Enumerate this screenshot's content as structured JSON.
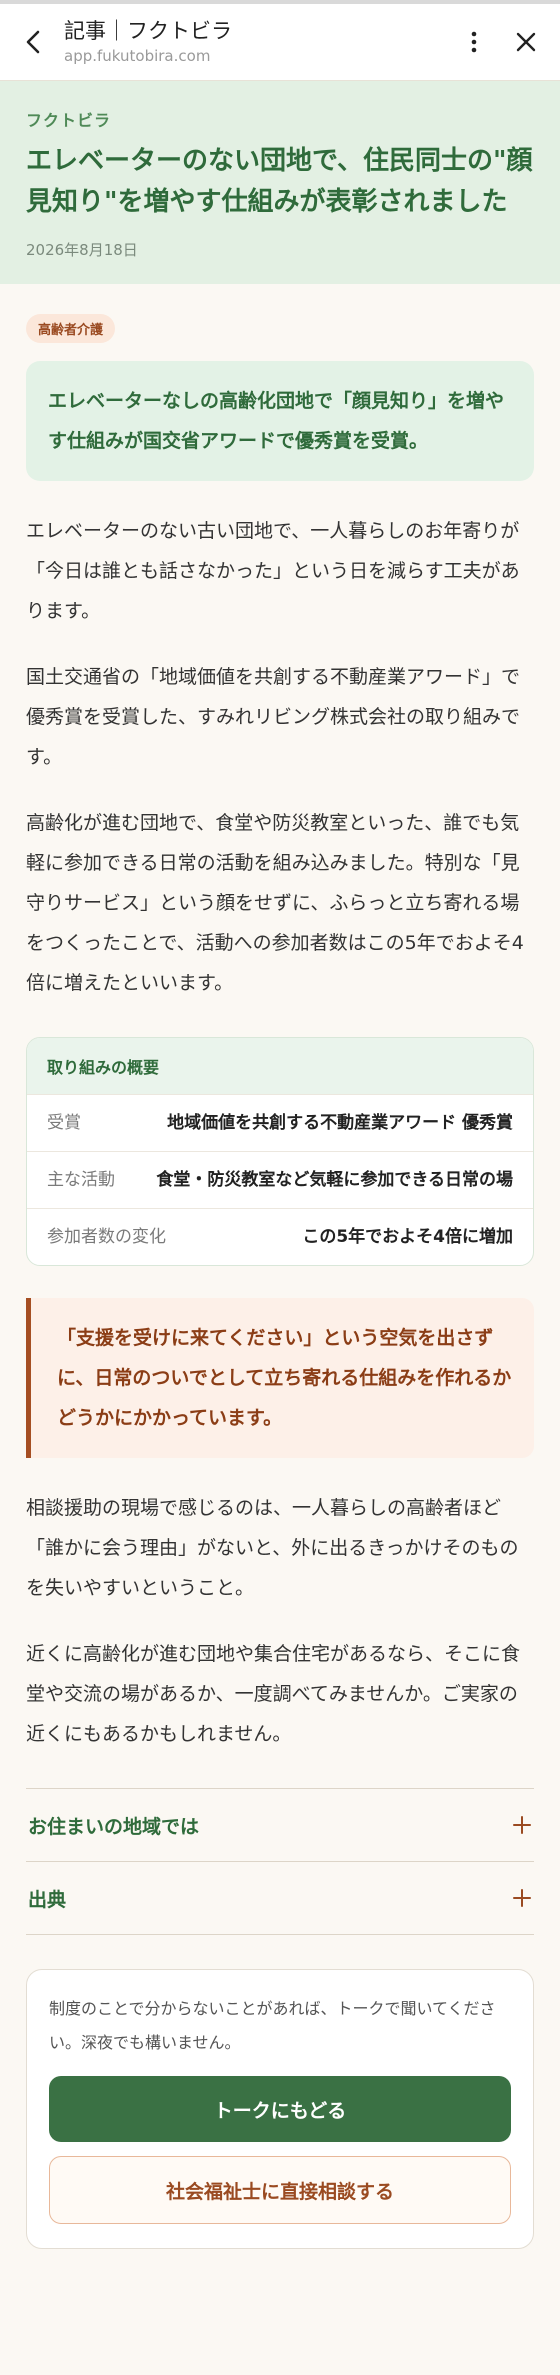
{
  "appbar": {
    "title": "記事｜フクトビラ",
    "url": "app.fukutobira.com",
    "icons": [
      "chevron-left-icon",
      "more-vertical-icon",
      "close-icon"
    ]
  },
  "hero": {
    "brand": "フクトビラ",
    "headline": "エレベーターのない団地で、住民同士の\"顔見知り\"を増やす仕組みが表彰されました",
    "date": "2026年8月18日"
  },
  "article": {
    "tag": "高齢者介護",
    "lead": "エレベーターなしの高齢化団地で「顔見知り」を増やす仕組みが国交省アワードで優秀賞を受賞。",
    "paragraphs": [
      "エレベーターのない古い団地で、一人暮らしのお年寄りが「今日は誰とも話さなかった」という日を減らす工夫があります。",
      "国土交通省の「地域価値を共創する不動産業アワード」で優秀賞を受賞した、すみれリビング株式会社の取り組みです。",
      "高齢化が進む団地で、食堂や防災教室といった、誰でも気軽に参加できる日常の活動を組み込みました。特別な「見守りサービス」という顔をせずに、ふらっと立ち寄れる場をつくったことで、活動への参加者数はこの5年でおよそ4倍に増えたといいます。"
    ],
    "summary": {
      "title": "取り組みの概要",
      "rows": [
        {
          "label": "受賞",
          "value": "地域価値を共創する不動産業アワード 優秀賞"
        },
        {
          "label": "主な活動",
          "value": "食堂・防災教室など気軽に参加できる日常の場"
        },
        {
          "label": "参加者数の変化",
          "value": "この5年でおよそ4倍に増加"
        }
      ]
    },
    "quote": "「支援を受けに来てください」という空気を出さずに、日常のついでとして立ち寄れる仕組みを作れるかどうかにかかっています。",
    "paragraphs_after": [
      "相談援助の現場で感じるのは、一人暮らしの高齢者ほど「誰かに会う理由」がないと、外に出るきっかけそのものを失いやすいということ。",
      "近くに高齢化が進む団地や集合住宅があるなら、そこに食堂や交流の場があるか、一度調べてみませんか。ご実家の近くにもあるかもしれません。"
    ],
    "accordions": [
      {
        "label": "お住まいの地域では",
        "icon": "plus-icon"
      },
      {
        "label": "出典",
        "icon": "plus-icon"
      }
    ]
  },
  "cta": {
    "note": "制度のことで分からないことがあれば、トークで聞いてください。深夜でも構いません。",
    "primary_label": "トークにもどる",
    "secondary_label": "社会福祉士に直接相談する"
  },
  "colors": {
    "accent_green": "#2f6b3b",
    "hero_bg": "#e3f0e3",
    "accent_brown": "#9a4a21",
    "page_bg": "#fbf8f3"
  }
}
